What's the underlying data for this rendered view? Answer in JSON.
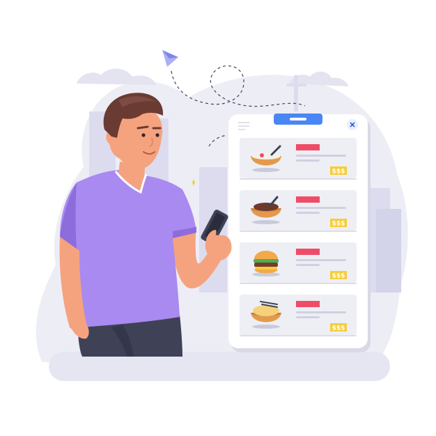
{
  "colors": {
    "background": "#ffffff",
    "scene_backdrop": "#ededf6",
    "building": "#dcdcee",
    "floor": "#e6e6f2",
    "app_card": "#ffffff",
    "menu_row": "#eeeef5",
    "row_divider": "#dedee8",
    "accent_blue": "#4a86f5",
    "title_bar_red": "#ee4d67",
    "price_badge_yellow": "#f7cd37",
    "text_line_gray": "#cfd1e0",
    "shirt": "#a98af0",
    "shirt_shadow": "#8d6cdc",
    "skin": "#f5a37e",
    "hair": "#6a3b33",
    "pants": "#3f4256"
  },
  "app": {
    "close_icon": "close-icon",
    "menu_icon": "hamburger-menu-icon",
    "items": [
      {
        "dish": "soup-bowl",
        "price": "$$$"
      },
      {
        "dish": "noodle-bowl",
        "price": "$$$"
      },
      {
        "dish": "burger",
        "price": "$$$"
      },
      {
        "dish": "rice-bowl",
        "price": "$$$"
      }
    ]
  },
  "decorations": {
    "paper_plane_icon": "paper-plane-icon",
    "dashed_flight_path": "dashed-loop-line"
  }
}
